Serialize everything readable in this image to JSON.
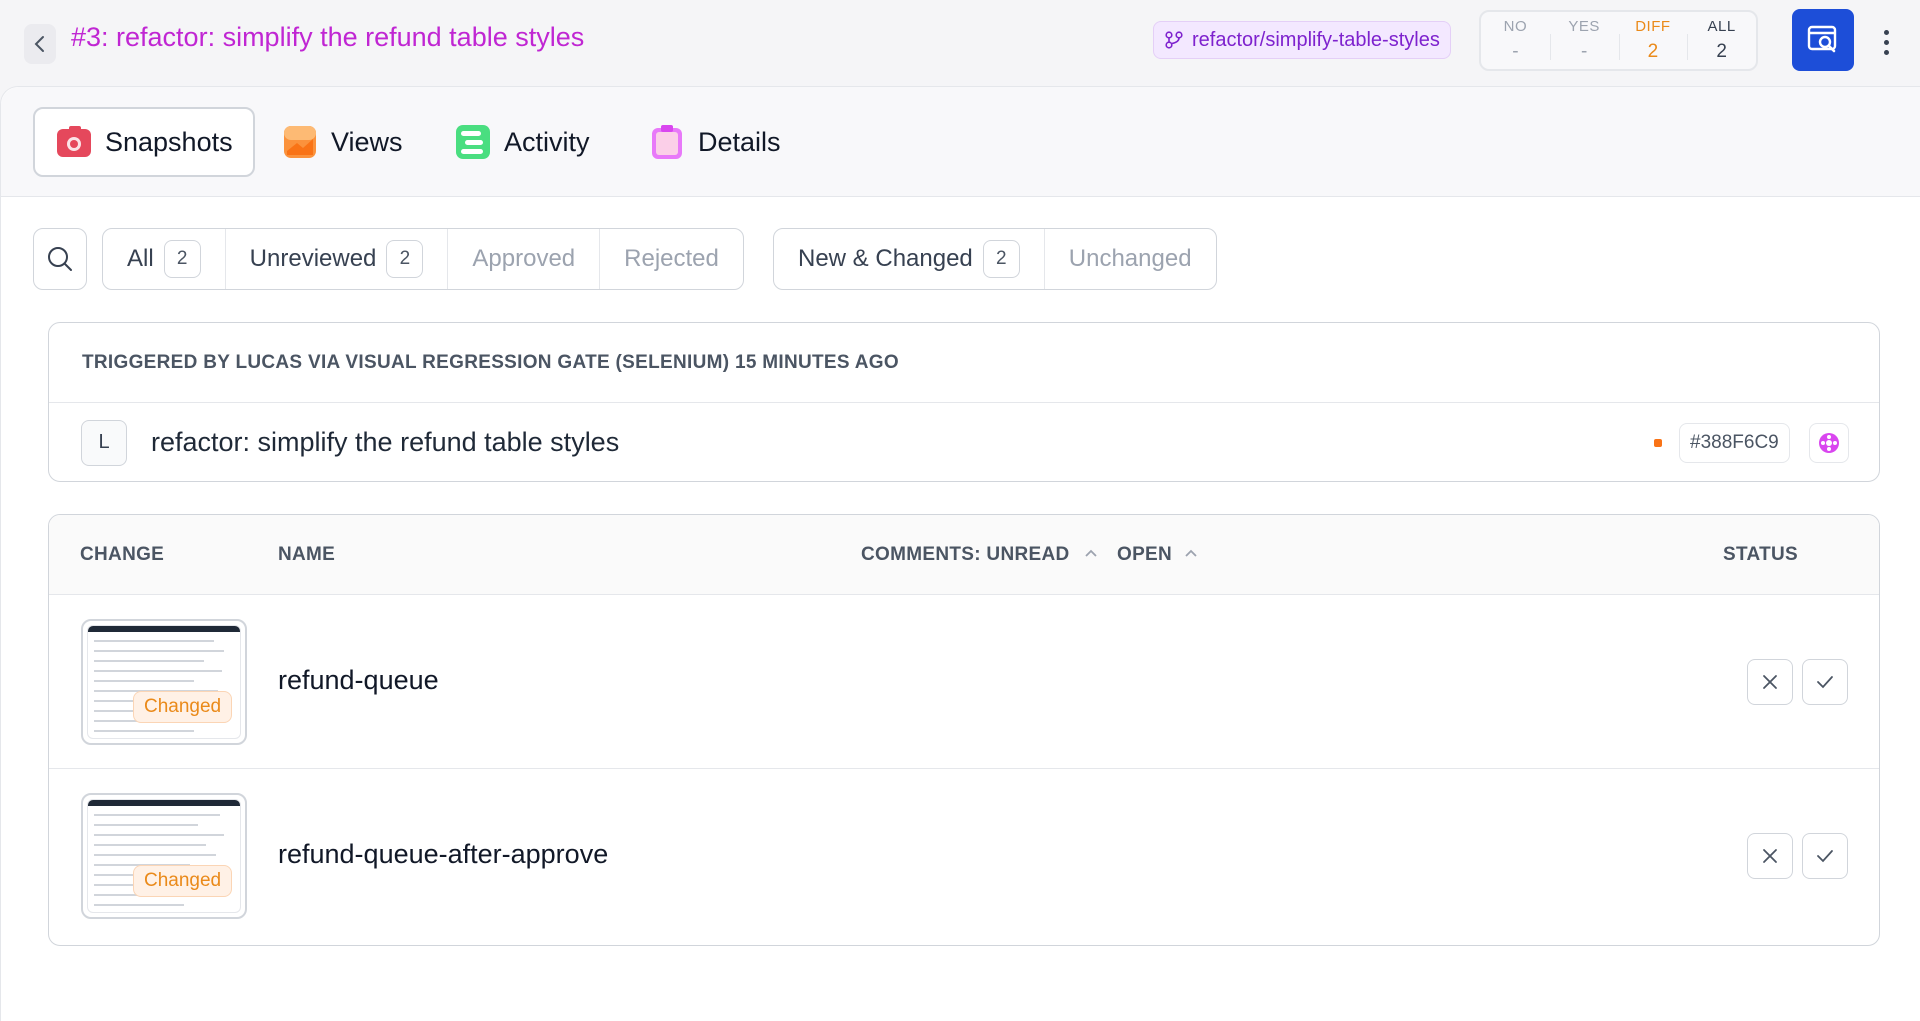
{
  "header": {
    "title": "#3: refactor: simplify the refund table styles",
    "branch": "refactor/simplify-table-styles",
    "stats": [
      {
        "label": "NO",
        "value": "-"
      },
      {
        "label": "YES",
        "value": "-"
      },
      {
        "label": "DIFF",
        "value": "2"
      },
      {
        "label": "ALL",
        "value": "2"
      }
    ]
  },
  "tabs": [
    {
      "label": "Snapshots",
      "icon": "camera-icon",
      "active": true
    },
    {
      "label": "Views",
      "icon": "views-icon"
    },
    {
      "label": "Activity",
      "icon": "activity-icon"
    },
    {
      "label": "Details",
      "icon": "clipboard-icon"
    }
  ],
  "filters": {
    "review": [
      {
        "label": "All",
        "count": "2"
      },
      {
        "label": "Unreviewed",
        "count": "2"
      },
      {
        "label": "Approved"
      },
      {
        "label": "Rejected"
      }
    ],
    "change": [
      {
        "label": "New & Changed",
        "count": "2"
      },
      {
        "label": "Unchanged"
      }
    ]
  },
  "trigger": {
    "heading": "TRIGGERED BY LUCAS VIA VISUAL REGRESSION GATE (SELENIUM) 15 MINUTES AGO",
    "avatar": "L",
    "commit_message": "refactor: simplify the refund table styles",
    "hash": "#388F6C9"
  },
  "table": {
    "columns": {
      "change": "CHANGE",
      "name": "NAME",
      "comments_unread": "COMMENTS: UNREAD",
      "open": "OPEN",
      "status": "STATUS"
    },
    "rows": [
      {
        "name": "refund-queue",
        "change": "Changed"
      },
      {
        "name": "refund-queue-after-approve",
        "change": "Changed"
      }
    ]
  },
  "colors": {
    "title": "#c026d3",
    "accent": "#1d4ed8",
    "diff": "#ea8a1a",
    "branch_bg": "#f3e8ff"
  }
}
